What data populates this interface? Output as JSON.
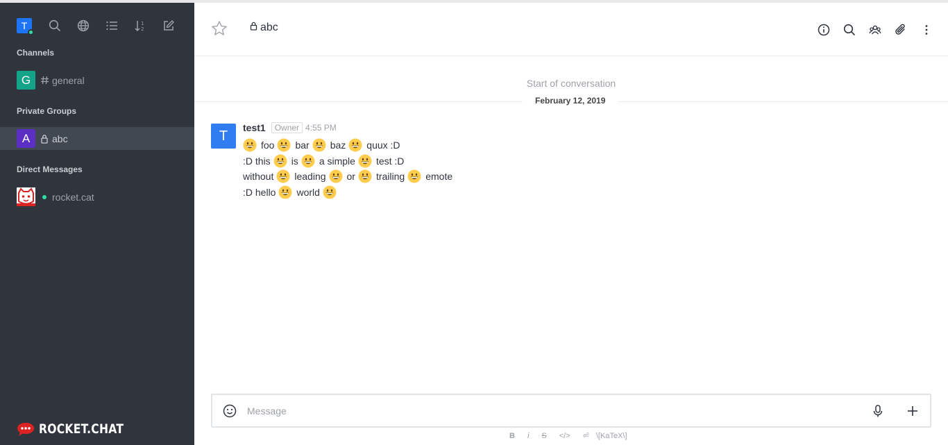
{
  "colors": {
    "sidebar_bg": "#2f343d",
    "accent_blue": "#1d74f5",
    "online": "#2de0a5",
    "general_avatar": "#12a389",
    "abc_avatar": "#5b2fc4"
  },
  "sidebar": {
    "user_initial": "T",
    "sections": {
      "channels": "Channels",
      "private_groups": "Private Groups",
      "direct_messages": "Direct Messages"
    },
    "channels": [
      {
        "initial": "G",
        "name": "general"
      }
    ],
    "groups": [
      {
        "initial": "A",
        "name": "abc",
        "active": true
      }
    ],
    "directs": [
      {
        "name": "rocket.cat"
      }
    ],
    "logo_text": "ROCKET.CHAT",
    "toolbar_icons": [
      "user-avatar",
      "search-icon",
      "globe-icon",
      "list-icon",
      "sort-icon",
      "edit-icon"
    ]
  },
  "header": {
    "room_name": "abc",
    "actions": [
      "info-icon",
      "search-icon",
      "members-icon",
      "attachment-icon",
      "kebab-icon"
    ]
  },
  "conversation": {
    "start_text": "Start of conversation",
    "date": "February 12, 2019"
  },
  "message": {
    "avatar_initial": "T",
    "username": "test1",
    "role": "Owner",
    "time": "4:55 PM",
    "lines": [
      [
        ":E:",
        "foo",
        ":E:",
        "bar",
        ":E:",
        "baz",
        ":E:",
        "quux :D"
      ],
      [
        ":D this",
        ":E:",
        "is",
        ":E:",
        "a simple",
        ":E:",
        "test :D"
      ],
      [
        "without",
        ":E:",
        "leading",
        ":E:",
        "or",
        ":E:",
        "trailing",
        ":E:",
        "emote"
      ],
      [
        ":D hello",
        ":E:",
        "world",
        ":E:"
      ]
    ]
  },
  "composer": {
    "placeholder": "Message"
  },
  "formatting": {
    "bold": "B",
    "italic": "i",
    "strike": "S",
    "code": "</>",
    "multiline": "⏎",
    "katex": "\\[KaTeX\\]"
  }
}
